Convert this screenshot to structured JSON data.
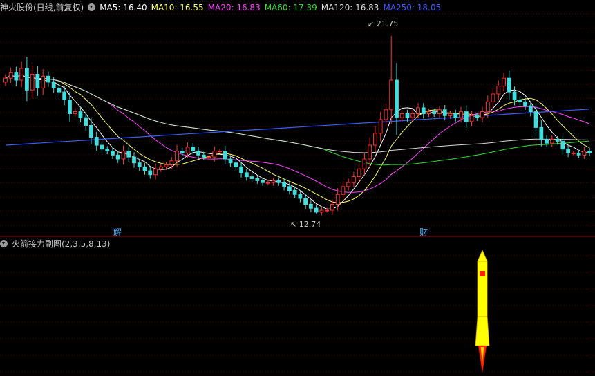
{
  "header": {
    "stock_name": "神火股份(日线,前复权)",
    "ma": [
      {
        "label": "MA5: 16.40",
        "color": "#ffffff"
      },
      {
        "label": "MA10: 16.55",
        "color": "#ffff66"
      },
      {
        "label": "MA20: 16.83",
        "color": "#ff44ff"
      },
      {
        "label": "MA60: 17.39",
        "color": "#33dd33"
      },
      {
        "label": "MA120: 16.83",
        "color": "#d8d8d8"
      },
      {
        "label": "MA250: 18.05",
        "color": "#3a5cff"
      }
    ]
  },
  "sub_header": {
    "indicator": "火箭接力副图(2,3,5,8,13)"
  },
  "events": [
    "解",
    "财"
  ],
  "chart_data": {
    "type": "candlestick",
    "high_label": "21.75",
    "low_label": "12.74",
    "y_range": [
      12.2,
      22.8
    ],
    "colors": {
      "up": "#ff3333",
      "down": "#44dddd",
      "ma5": "#ffffff",
      "ma10": "#ffff66",
      "ma20": "#ff44ff",
      "ma60": "#33dd33",
      "ma120": "#d8d8d8",
      "ma250": "#3a5cff",
      "rocket_body": "#ffff00",
      "rocket_flame": "#ff2200"
    },
    "rocket_at_index": 89,
    "ohlc_closes": [
      19.6,
      19.9,
      19.5,
      20.1,
      19.0,
      19.8,
      19.1,
      19.7,
      19.4,
      19.1,
      18.9,
      18.5,
      17.8,
      17.9,
      17.6,
      17.2,
      16.6,
      16.2,
      16.0,
      15.9,
      15.7,
      15.5,
      15.9,
      15.6,
      15.3,
      15.1,
      14.9,
      14.7,
      15.0,
      15.1,
      15.2,
      15.4,
      15.9,
      15.8,
      16.1,
      15.9,
      15.7,
      15.6,
      15.6,
      15.9,
      15.9,
      15.5,
      15.3,
      15.1,
      14.8,
      14.6,
      14.5,
      14.4,
      14.3,
      14.3,
      14.4,
      14.3,
      14.1,
      13.9,
      13.7,
      13.5,
      13.2,
      13.0,
      12.8,
      12.9,
      12.9,
      13.2,
      13.7,
      14.1,
      14.3,
      14.6,
      15.0,
      15.5,
      16.2,
      16.8,
      17.5,
      18.0,
      19.5,
      17.6,
      17.8,
      17.6,
      17.8,
      18.1,
      17.8,
      17.9,
      17.8,
      18.0,
      17.7,
      17.8,
      17.6,
      17.9,
      17.4,
      17.7,
      17.6,
      17.9,
      18.4,
      18.8,
      19.2,
      19.6,
      18.9,
      18.5,
      18.4,
      18.2,
      17.9,
      17.1,
      16.5,
      16.3,
      16.5,
      16.4,
      16.0,
      15.8,
      15.8,
      15.7,
      15.9,
      15.8
    ]
  }
}
